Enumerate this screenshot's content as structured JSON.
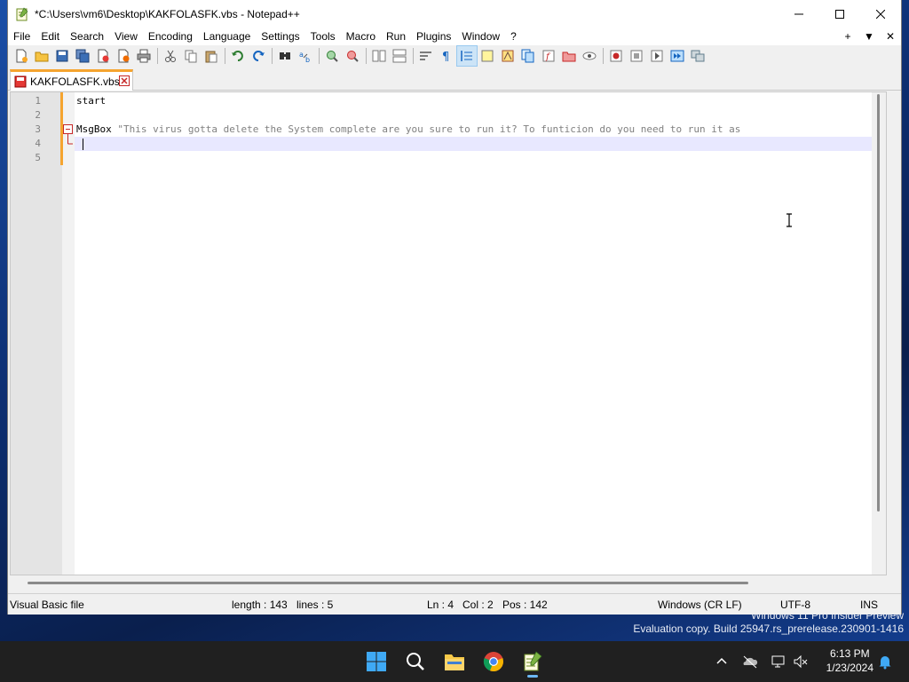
{
  "window": {
    "title": "*C:\\Users\\vm6\\Desktop\\KAKFOLASFK.vbs - Notepad++"
  },
  "menu": {
    "items": [
      "File",
      "Edit",
      "Search",
      "View",
      "Encoding",
      "Language",
      "Settings",
      "Tools",
      "Macro",
      "Run",
      "Plugins",
      "Window",
      "?"
    ],
    "right_controls": [
      "+",
      "▼",
      "✕"
    ]
  },
  "toolbar": {
    "icons": [
      "new-file-icon",
      "open-file-icon",
      "save-icon",
      "save-all-icon",
      "close-icon",
      "close-all-icon",
      "print-icon",
      "cut-icon",
      "copy-icon",
      "paste-icon",
      "undo-icon",
      "redo-icon",
      "find-icon",
      "replace-icon",
      "zoom-in-icon",
      "zoom-out-icon",
      "sync-vertical-icon",
      "sync-horizontal-icon",
      "word-wrap-icon",
      "show-all-chars-icon",
      "indent-guide-icon",
      "lang-udl-icon",
      "doc-map-icon",
      "doc-list-icon",
      "function-list-icon",
      "folder-workspace-icon",
      "monitoring-icon",
      "record-macro-icon",
      "stop-recording-icon",
      "play-macro-icon",
      "run-macro-multiple-icon",
      "save-macro-icon"
    ]
  },
  "tabs": [
    {
      "label": "KAKFOLASFK.vbs",
      "active": true,
      "modified": true
    }
  ],
  "editor": {
    "lines": [
      {
        "number": "1",
        "text": "start"
      },
      {
        "number": "2",
        "text": ""
      },
      {
        "number": "3",
        "keyword": "MsgBox",
        "string": " \"This virus gotta delete the System complete are you sure to run it? To funticion do you need to run it as"
      },
      {
        "number": "4",
        "text": ""
      },
      {
        "number": "5",
        "text": ""
      }
    ]
  },
  "statusbar": {
    "file_type": "Visual Basic file",
    "length": "length : 143",
    "lines": "lines : 5",
    "ln": "Ln : 4",
    "col": "Col : 2",
    "pos": "Pos : 142",
    "eol": "Windows (CR LF)",
    "encoding": "UTF-8",
    "mode": "INS"
  },
  "desktop": {
    "watermark_line1": "Windows 11 Pro Insider Preview",
    "watermark_line2": "Evaluation copy. Build 25947.rs_prerelease.230901-1416"
  },
  "taskbar": {
    "apps": [
      "start-icon",
      "search-icon",
      "file-explorer-icon",
      "chrome-icon",
      "notepadpp-icon"
    ],
    "time": "6:13 PM",
    "date": "1/23/2024"
  },
  "colors": {
    "tab_accent": "#f5a42f",
    "current_line": "#e8e8ff",
    "string": "#808080"
  }
}
